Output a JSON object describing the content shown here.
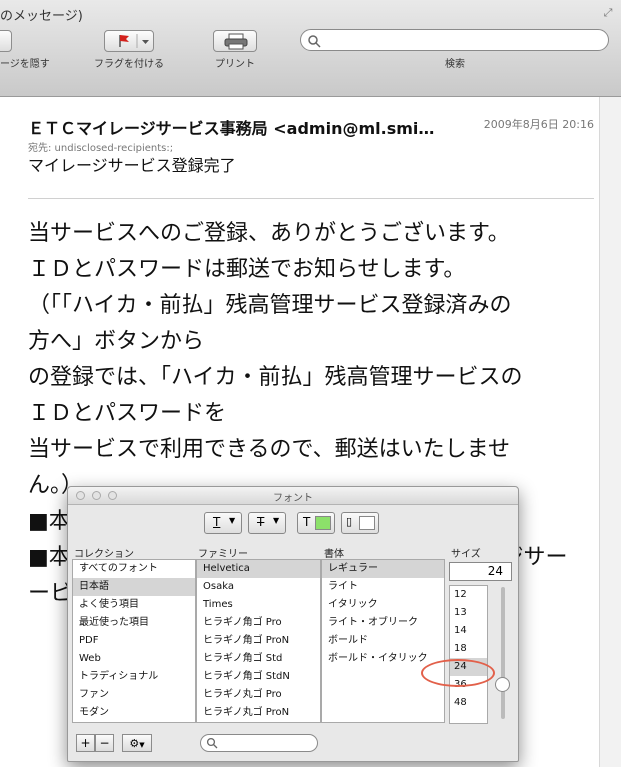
{
  "window": {
    "title": "のメッセージ)"
  },
  "toolbar": {
    "hide_label": "ージを隠す",
    "flag_label": "フラグを付ける",
    "print_label": "プリント",
    "search_label": "検索",
    "search_placeholder": ""
  },
  "message": {
    "from": "ＥＴＣマイレージサービス事務局 <admin@ml.smi…",
    "date": "2009年8月6日 20:16",
    "to": "宛先:  undisclosed-recipients:;",
    "subject": "マイレージサービス登録完了",
    "body_lines": [
      "当サービスへのご登録、ありがとうございます。",
      "ＩＤとパスワードは郵送でお知らせします。",
      "（「「ハイカ・前払」残高管理サービス登録済みの",
      "方へ」ボタンから",
      "の登録では、「ハイカ・前払」残高管理サービスの",
      "ＩＤとパスワードを",
      "当サービスで利用できるので、郵送はいたしませ",
      "ん。）"
    ],
    "partial_line1_left": "■本",
    "partial_line2_left": "■本",
    "partial_line2_right": "ージサー",
    "partial_line3_left": "ービ"
  },
  "font_panel": {
    "title": "フォント",
    "effects": {
      "text_color_sample": "#8ce06a",
      "doc_color_sample": "#ffffff"
    },
    "headers": {
      "collection": "コレクション",
      "family": "ファミリー",
      "typeface": "書体",
      "size": "サイズ"
    },
    "collections": [
      "すべてのフォント",
      "日本語",
      "よく使う項目",
      "最近使った項目",
      "PDF",
      "Web",
      "トラディショナル",
      "ファン",
      "モダン"
    ],
    "collection_selected": 1,
    "families": [
      "Helvetica",
      "Osaka",
      "Times",
      "ヒラギノ角ゴ Pro",
      "ヒラギノ角ゴ ProN",
      "ヒラギノ角ゴ Std",
      "ヒラギノ角ゴ StdN",
      "ヒラギノ丸ゴ Pro",
      "ヒラギノ丸ゴ ProN"
    ],
    "family_selected": 0,
    "typefaces": [
      "レギュラー",
      "ライト",
      "イタリック",
      "ライト・オブリーク",
      "ボールド",
      "ボールド・イタリック"
    ],
    "typeface_selected": 0,
    "size_value": "24",
    "sizes": [
      "12",
      "13",
      "14",
      "18",
      "24",
      "36",
      "48"
    ],
    "size_selected": 4,
    "add_label": "+",
    "remove_label": "−"
  }
}
